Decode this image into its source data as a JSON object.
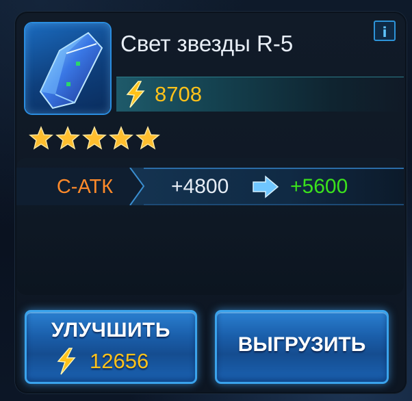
{
  "item": {
    "name": "Свет звезды R-5",
    "power": "8708",
    "icon": "blue-crystal-icon",
    "stars": 5
  },
  "info_label": "i",
  "stat": {
    "label": "С-АТК",
    "current": "+4800",
    "next": "+5600"
  },
  "buttons": {
    "upgrade_label": "УЛУЧШИТЬ",
    "upgrade_cost": "12656",
    "unload_label": "ВЫГРУЗИТЬ"
  },
  "colors": {
    "power": "#ffc21a",
    "stat_label": "#ff8a2a",
    "stat_next": "#3be21c",
    "button": "#1a5eaa"
  }
}
